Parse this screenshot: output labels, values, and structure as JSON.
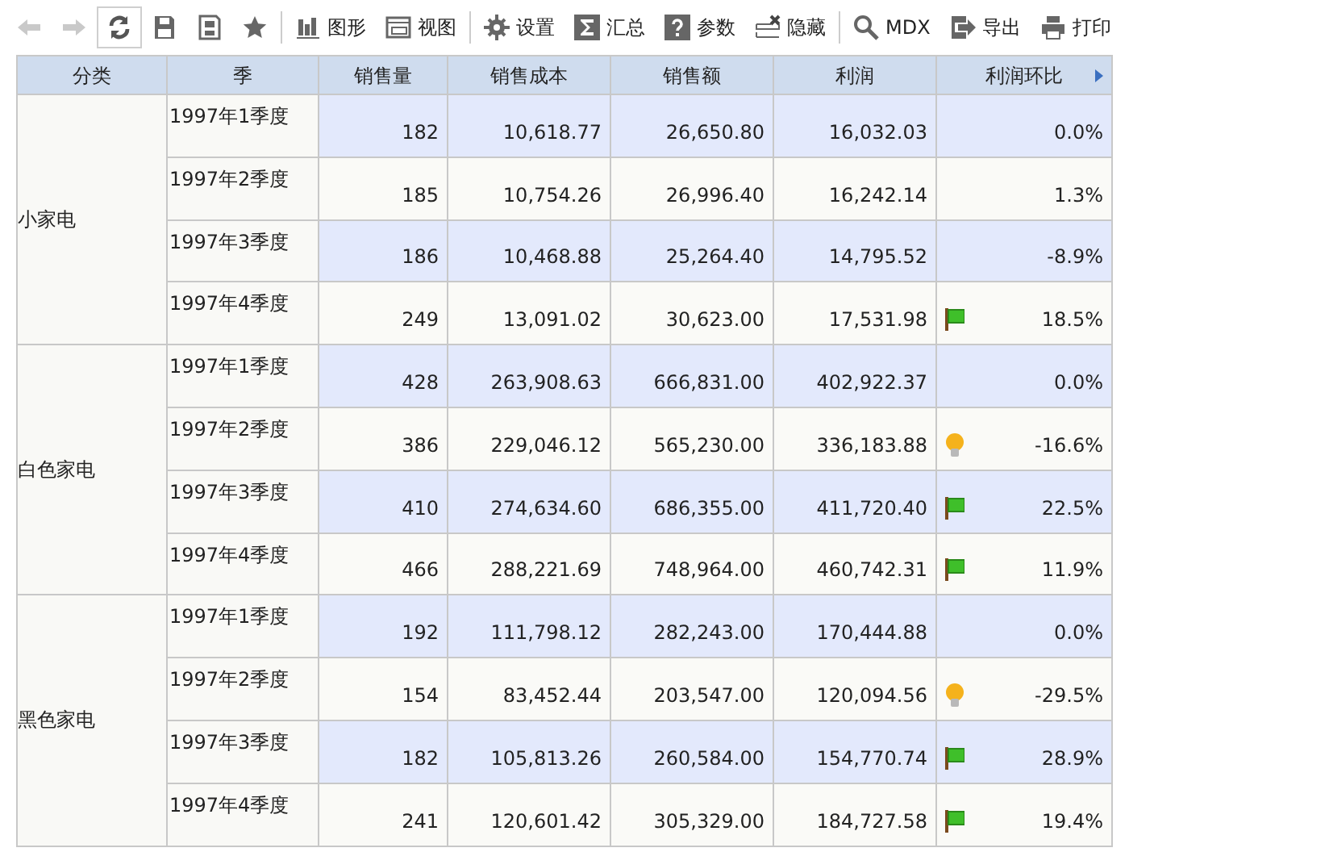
{
  "toolbar": [
    {
      "disabled": true,
      "pressed": false
    },
    {
      "disabled": true,
      "pressed": false
    },
    {
      "disabled": false,
      "pressed": true
    },
    {
      "disabled": false,
      "pressed": false
    },
    {
      "disabled": false,
      "pressed": false
    },
    {
      "disabled": false,
      "pressed": false
    },
    {
      "label": "图形",
      "disabled": false,
      "pressed": false
    },
    {
      "label": "视图",
      "disabled": false,
      "pressed": false
    },
    {
      "label": "设置",
      "disabled": false,
      "pressed": false
    },
    {
      "label": "汇总",
      "disabled": false,
      "pressed": false
    },
    {
      "label": "参数",
      "disabled": false,
      "pressed": false
    },
    {
      "label": "隐藏",
      "disabled": false,
      "pressed": false
    },
    {
      "label": "MDX",
      "disabled": false,
      "pressed": false
    },
    {
      "label": "导出",
      "disabled": false,
      "pressed": false
    },
    {
      "label": "打印",
      "disabled": false,
      "pressed": false
    }
  ],
  "table": {
    "columns": [
      "分类",
      "季",
      "销售量",
      "销售成本",
      "销售额",
      "利润",
      "利润环比"
    ],
    "groups": [
      {
        "category": "小家电",
        "rows": [
          {
            "quarter": "1997年1季度",
            "values": [
              "182",
              "10,618.77",
              "26,650.80",
              "16,032.03"
            ],
            "kind": "plain",
            "change": "0.0%"
          },
          {
            "quarter": "1997年2季度",
            "values": [
              "185",
              "10,754.26",
              "26,996.40",
              "16,242.14"
            ],
            "kind": "plain",
            "change": "1.3%"
          },
          {
            "quarter": "1997年3季度",
            "values": [
              "186",
              "10,468.88",
              "25,264.40",
              "14,795.52"
            ],
            "kind": "plain",
            "change": "-8.9%"
          },
          {
            "quarter": "1997年4季度",
            "values": [
              "249",
              "13,091.02",
              "30,623.00",
              "17,531.98"
            ],
            "kind": "flag",
            "change": "18.5%"
          }
        ]
      },
      {
        "category": "白色家电",
        "rows": [
          {
            "quarter": "1997年1季度",
            "values": [
              "428",
              "263,908.63",
              "666,831.00",
              "402,922.37"
            ],
            "kind": "plain",
            "change": "0.0%"
          },
          {
            "quarter": "1997年2季度",
            "values": [
              "386",
              "229,046.12",
              "565,230.00",
              "336,183.88"
            ],
            "kind": "bulb",
            "change": "-16.6%"
          },
          {
            "quarter": "1997年3季度",
            "values": [
              "410",
              "274,634.60",
              "686,355.00",
              "411,720.40"
            ],
            "kind": "flag",
            "change": "22.5%"
          },
          {
            "quarter": "1997年4季度",
            "values": [
              "466",
              "288,221.69",
              "748,964.00",
              "460,742.31"
            ],
            "kind": "flag",
            "change": "11.9%"
          }
        ]
      },
      {
        "category": "黑色家电",
        "rows": [
          {
            "quarter": "1997年1季度",
            "values": [
              "192",
              "111,798.12",
              "282,243.00",
              "170,444.88"
            ],
            "kind": "plain",
            "change": "0.0%"
          },
          {
            "quarter": "1997年2季度",
            "values": [
              "154",
              "83,452.44",
              "203,547.00",
              "120,094.56"
            ],
            "kind": "bulb",
            "change": "-29.5%"
          },
          {
            "quarter": "1997年3季度",
            "values": [
              "182",
              "105,813.26",
              "260,584.00",
              "154,770.74"
            ],
            "kind": "flag",
            "change": "28.9%"
          },
          {
            "quarter": "1997年4季度",
            "values": [
              "241",
              "120,601.42",
              "305,329.00",
              "184,727.58"
            ],
            "kind": "flag",
            "change": "19.4%"
          }
        ]
      }
    ]
  }
}
